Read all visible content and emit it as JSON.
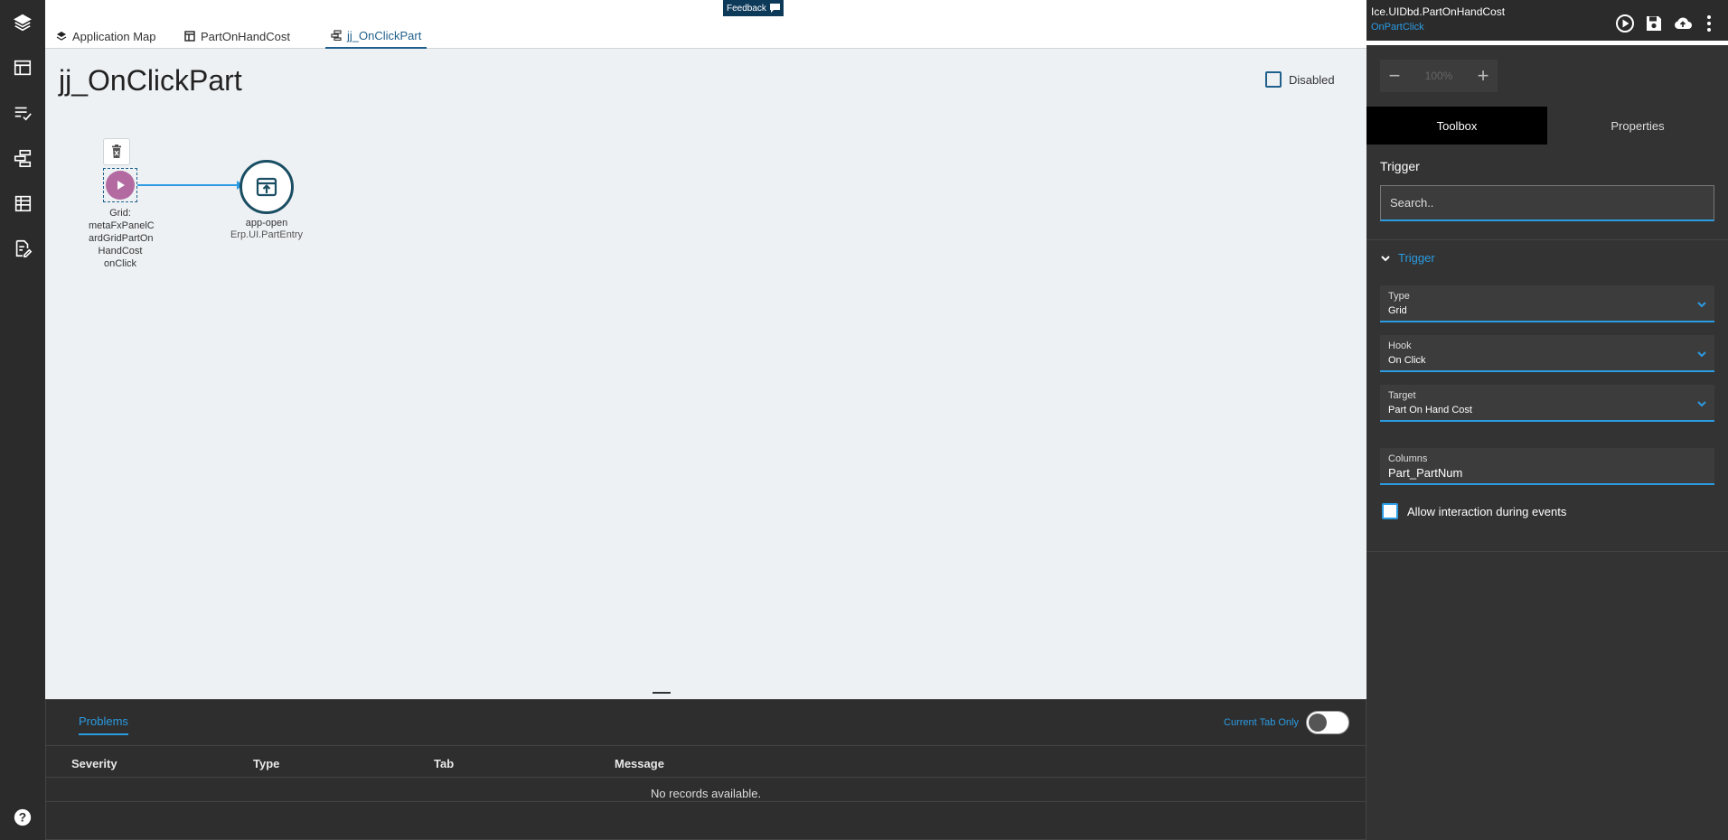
{
  "rail": {
    "icons": [
      "layers-icon",
      "layout-icon",
      "list-check-icon",
      "flow-icon",
      "table-icon",
      "document-edit-icon",
      "help-icon"
    ]
  },
  "tabs": [
    {
      "label": "Application Map",
      "icon": "layers-icon"
    },
    {
      "label": "PartOnHandCost",
      "icon": "grid-icon"
    },
    {
      "label": "jj_OnClickPart",
      "icon": "flow-icon",
      "active": true
    }
  ],
  "feedback": {
    "label": "Feedback",
    "icon": "comment-icon"
  },
  "canvas": {
    "title": "jj_OnClickPart",
    "disabled_label": "Disabled",
    "trigger_node": {
      "label": "Grid:\nmetaFxPanelC\nardGridPartOn\nHandCost\nonClick"
    },
    "action_node": {
      "label": "app-open",
      "sublabel": "Erp.UI.PartEntry"
    }
  },
  "problems": {
    "tab_label": "Problems",
    "current_tab_only_label": "Current Tab Only",
    "columns": [
      "Severity",
      "Type",
      "Tab",
      "Message"
    ],
    "empty_message": "No records available."
  },
  "right_panel": {
    "title": "Ice.UIDbd.PartOnHandCost",
    "subtitle": "OnPartClick",
    "zoom": {
      "value": "100%"
    },
    "tabs": [
      {
        "label": "Toolbox",
        "active": true
      },
      {
        "label": "Properties"
      }
    ],
    "section_label": "Trigger",
    "search_placeholder": "Search..",
    "trigger_group_label": "Trigger",
    "fields": {
      "type": {
        "label": "Type",
        "value": "Grid"
      },
      "hook": {
        "label": "Hook",
        "value": "On Click"
      },
      "target": {
        "label": "Target",
        "value": "Part On Hand Cost"
      },
      "columns": {
        "label": "Columns",
        "value": "Part_PartNum"
      }
    },
    "allow_interaction_label": "Allow interaction during events"
  },
  "colors": {
    "accent": "#2b9be2",
    "dark_panel": "#333333",
    "trigger_node": "#b26aa0",
    "action_node": "#1a4e63"
  }
}
